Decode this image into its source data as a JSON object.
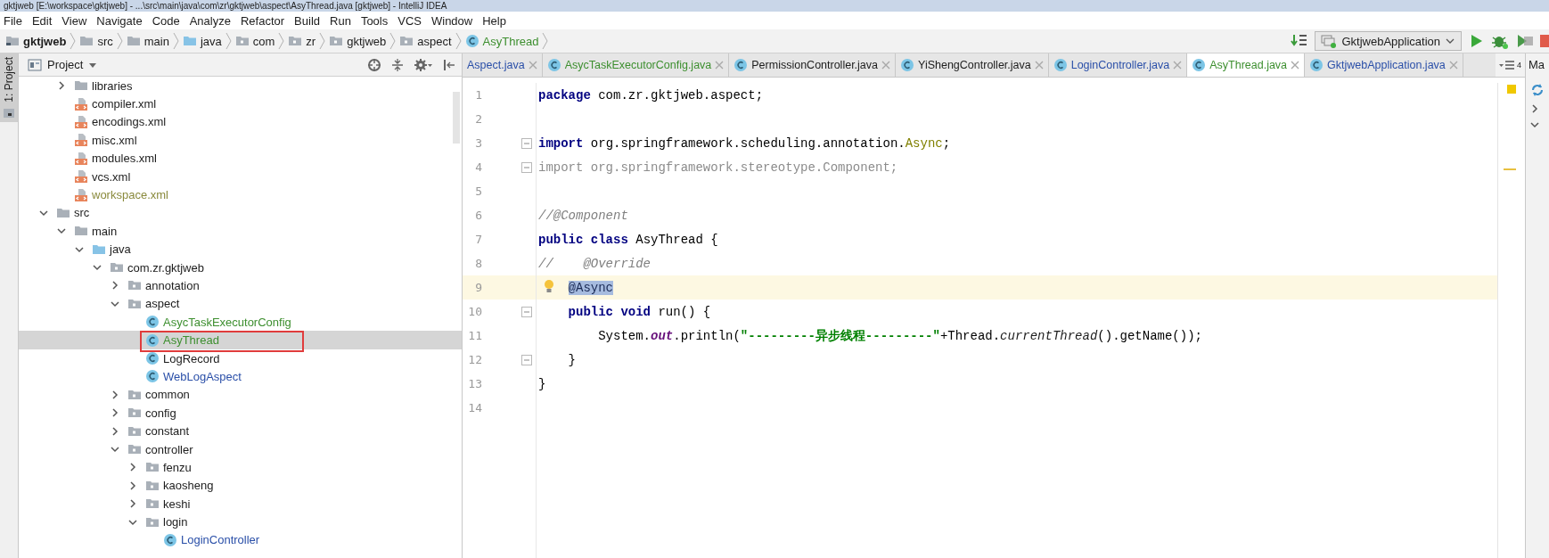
{
  "window": {
    "title": "gktjweb [E:\\workspace\\gktjweb] - ...\\src\\main\\java\\com\\zr\\gktjweb\\aspect\\AsyThread.java [gktjweb] - IntelliJ IDEA"
  },
  "menu": [
    "File",
    "Edit",
    "View",
    "Navigate",
    "Code",
    "Analyze",
    "Refactor",
    "Build",
    "Run",
    "Tools",
    "VCS",
    "Window",
    "Help"
  ],
  "breadcrumbs": [
    {
      "label": "gktjweb",
      "kind": "module"
    },
    {
      "label": "src",
      "kind": "folder"
    },
    {
      "label": "main",
      "kind": "folder"
    },
    {
      "label": "java",
      "kind": "source"
    },
    {
      "label": "com",
      "kind": "package"
    },
    {
      "label": "zr",
      "kind": "package"
    },
    {
      "label": "gktjweb",
      "kind": "package"
    },
    {
      "label": "aspect",
      "kind": "package"
    },
    {
      "label": "AsyThread",
      "kind": "class",
      "color": "#3d8f2f"
    }
  ],
  "run_config": {
    "label": "GktjwebApplication"
  },
  "left_stripe": {
    "label": "1: Project",
    "selected": true
  },
  "project_panel": {
    "title": "Project",
    "tree_partial": [
      {
        "label": "libraries",
        "kind": "folder",
        "expanded": false,
        "selected": false
      },
      {
        "label": "compiler.xml",
        "kind": "xml",
        "selected": false
      },
      {
        "label": "encodings.xml",
        "kind": "xml",
        "selected": false
      },
      {
        "label": "misc.xml",
        "kind": "xml",
        "selected": false
      },
      {
        "label": "modules.xml",
        "kind": "xml",
        "selected": false
      },
      {
        "label": "vcs.xml",
        "kind": "xml",
        "selected": false
      },
      {
        "label": "workspace.xml",
        "kind": "xml",
        "selected": false,
        "color": "#8a8a3c"
      }
    ],
    "tree": [
      {
        "label": "src",
        "kind": "folder",
        "expanded": true,
        "selected": false,
        "children": [
          {
            "label": "main",
            "kind": "folder",
            "expanded": true,
            "selected": false,
            "children": [
              {
                "label": "java",
                "kind": "source",
                "expanded": true,
                "selected": false,
                "children": [
                  {
                    "label": "com.zr.gktjweb",
                    "kind": "package",
                    "expanded": true,
                    "selected": false,
                    "children": [
                      {
                        "label": "annotation",
                        "kind": "package",
                        "expanded": false,
                        "selected": false
                      },
                      {
                        "label": "aspect",
                        "kind": "package",
                        "expanded": true,
                        "selected": false,
                        "children": [
                          {
                            "label": "AsycTaskExecutorConfig",
                            "kind": "class",
                            "selected": false,
                            "color": "#3d8f2f"
                          },
                          {
                            "label": "AsyThread",
                            "kind": "class",
                            "selected": true,
                            "color": "#3d8f2f",
                            "outlined": true
                          },
                          {
                            "label": "LogRecord",
                            "kind": "class",
                            "selected": false
                          },
                          {
                            "label": "WebLogAspect",
                            "kind": "class",
                            "selected": false,
                            "color": "#2a4fa8"
                          }
                        ]
                      },
                      {
                        "label": "common",
                        "kind": "package",
                        "expanded": false,
                        "selected": false
                      },
                      {
                        "label": "config",
                        "kind": "package",
                        "expanded": false,
                        "selected": false
                      },
                      {
                        "label": "constant",
                        "kind": "package",
                        "expanded": false,
                        "selected": false
                      },
                      {
                        "label": "controller",
                        "kind": "package",
                        "expanded": true,
                        "selected": false,
                        "children": [
                          {
                            "label": "fenzu",
                            "kind": "package",
                            "expanded": false,
                            "selected": false
                          },
                          {
                            "label": "kaosheng",
                            "kind": "package",
                            "expanded": false,
                            "selected": false
                          },
                          {
                            "label": "keshi",
                            "kind": "package",
                            "expanded": false,
                            "selected": false
                          },
                          {
                            "label": "login",
                            "kind": "package",
                            "expanded": true,
                            "selected": false,
                            "children": [
                              {
                                "label": "LoginController",
                                "kind": "class",
                                "selected": false,
                                "color": "#2a4fa8"
                              }
                            ]
                          }
                        ]
                      }
                    ]
                  }
                ]
              }
            ]
          }
        ]
      }
    ]
  },
  "editor_tabs": [
    {
      "label": "Aspect.java",
      "selected": false,
      "color": "#2a4fa8",
      "icon": false
    },
    {
      "label": "AsycTaskExecutorConfig.java",
      "selected": false,
      "color": "#3d8f2f",
      "icon": true
    },
    {
      "label": "PermissionController.java",
      "selected": false,
      "icon": true
    },
    {
      "label": "YiShengController.java",
      "selected": false,
      "icon": true
    },
    {
      "label": "LoginController.java",
      "selected": false,
      "color": "#2a4fa8",
      "icon": true
    },
    {
      "label": "AsyThread.java",
      "selected": true,
      "color": "#3d8f2f",
      "icon": true
    },
    {
      "label": "GktjwebApplication.java",
      "selected": false,
      "color": "#2a4fa8",
      "icon": true
    }
  ],
  "tab_overflow": {
    "count": "4"
  },
  "code": [
    {
      "number": "1",
      "tokens": [
        {
          "kind": "keyword",
          "text": "package"
        },
        {
          "kind": "plain",
          "text": " com.zr.gktjweb.aspect;"
        }
      ]
    },
    {
      "number": "2"
    },
    {
      "number": "3",
      "fold": true,
      "tokens": [
        {
          "kind": "keyword",
          "text": "import"
        },
        {
          "kind": "plain",
          "text": " org.springframework.scheduling.annotation."
        },
        {
          "kind": "annotation",
          "text": "Async"
        },
        {
          "kind": "plain",
          "text": ";"
        }
      ]
    },
    {
      "number": "4",
      "fold": true,
      "tokens": [
        {
          "kind": "unused",
          "text": "import org.springframework.stereotype.Component;"
        }
      ]
    },
    {
      "number": "5"
    },
    {
      "number": "6",
      "tokens": [
        {
          "kind": "comment",
          "text": "//@Component"
        }
      ]
    },
    {
      "number": "7",
      "tokens": [
        {
          "kind": "keyword",
          "text": "public class"
        },
        {
          "kind": "plain",
          "text": " AsyThread {"
        }
      ]
    },
    {
      "number": "8",
      "tokens": [
        {
          "kind": "comment",
          "text": "//    @Override"
        }
      ]
    },
    {
      "number": "9",
      "current": true,
      "intention": true,
      "indented": true,
      "tokens": [
        {
          "kind": "annotation-ref",
          "text": "@Async",
          "selected": true
        }
      ]
    },
    {
      "number": "10",
      "fold": true,
      "indented": true,
      "tokens": [
        {
          "kind": "keyword",
          "text": "public void"
        },
        {
          "kind": "plain",
          "text": " run() {"
        }
      ]
    },
    {
      "number": "11",
      "indented": true,
      "tokens": [
        {
          "kind": "plain",
          "text": "    System."
        },
        {
          "kind": "static-field",
          "text": "out"
        },
        {
          "kind": "plain",
          "text": ".println("
        },
        {
          "kind": "string",
          "text": "\"---------异步线程---------\""
        },
        {
          "kind": "plain",
          "text": "+Thread."
        },
        {
          "kind": "static-method",
          "text": "currentThread"
        },
        {
          "kind": "plain",
          "text": "().getName());"
        }
      ]
    },
    {
      "number": "12",
      "fold": true,
      "indented": true,
      "tokens": [
        {
          "kind": "plain",
          "text": "}"
        }
      ]
    },
    {
      "number": "13",
      "tokens": [
        {
          "kind": "plain",
          "text": "}"
        }
      ]
    },
    {
      "number": "14"
    }
  ],
  "right_panel": {
    "title": "Ma"
  }
}
